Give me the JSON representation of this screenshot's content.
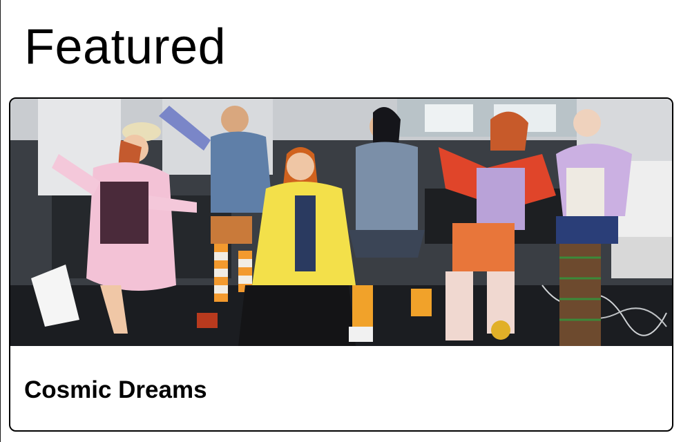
{
  "section": {
    "title": "Featured"
  },
  "featured_card": {
    "title": "Cosmic Dreams",
    "image_alt": "Group photo of six performers in colorful costumes posing in an office"
  }
}
